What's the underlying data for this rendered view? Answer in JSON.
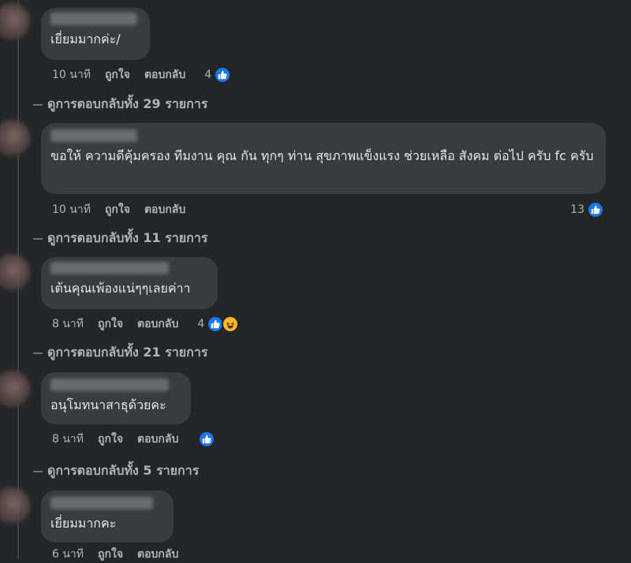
{
  "comments": [
    {
      "text": "เยี่ยมมากค่ะ/",
      "time": "10 นาที",
      "like": "ถูกใจ",
      "reply": "ตอบกลับ",
      "reactions": "4",
      "view_replies": "ดูการตอบกลับทั้ง 29 รายการ"
    },
    {
      "text": "ขอให้ ความดีคุ้มครอง ทีมงาน คุณ กัน ทุกๆ ท่าน สุขภาพแข็งแรง ช่วยเหลือ สังคม ต่อไป ครับ fc ครับ",
      "time": "10 นาที",
      "like": "ถูกใจ",
      "reply": "ตอบกลับ",
      "reactions": "13",
      "view_replies": "ดูการตอบกลับทั้ง 11 รายการ"
    },
    {
      "text": "เต้นคุณเพ้องแน่ๆๆเลยค่าา",
      "time": "8 นาที",
      "like": "ถูกใจ",
      "reply": "ตอบกลับ",
      "reactions": "4",
      "view_replies": "ดูการตอบกลับทั้ง 21 รายการ"
    },
    {
      "text": "อนุโมทนาสาธุด้วยคะ",
      "time": "8 นาที",
      "like": "ถูกใจ",
      "reply": "ตอบกลับ",
      "reactions": "",
      "view_replies": "ดูการตอบกลับทั้ง 5 รายการ"
    },
    {
      "text": "เยี่ยมมากคะ",
      "time": "6 นาที",
      "like": "ถูกใจ",
      "reply": "ตอบกลับ"
    }
  ],
  "colors": {
    "background": "#242526",
    "bubble": "#3a3b3c",
    "like_blue": "#1877f2",
    "haha_yellow": "#f7b928"
  },
  "icons": [
    "like-icon",
    "haha-icon"
  ]
}
